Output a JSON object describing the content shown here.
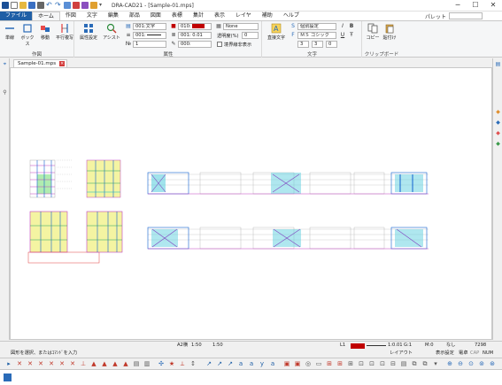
{
  "window": {
    "title": "DRA-CAD21 - [Sample-01.mps]",
    "minimize": "─",
    "maximize": "☐",
    "close": "✕"
  },
  "menu": {
    "tabs": [
      "ファイル",
      "ホーム",
      "作図",
      "文字",
      "編集",
      "部品",
      "図面",
      "表標",
      "集計",
      "表示",
      "レイヤ",
      "補助",
      "ヘルプ"
    ],
    "palette_label": "パレット"
  },
  "ribbon": {
    "draw_group": {
      "label": "作図",
      "buttons": [
        "単線",
        "ボックス",
        "移動",
        "平行複写"
      ]
    },
    "attr_group": {
      "label": "属性",
      "setting_button": "属性設定",
      "assist_button": "アシスト",
      "layer_value": "001:文字",
      "color_value": "010:",
      "line_value": "001:",
      "width_value": "001: 0.01",
      "num_value": "1",
      "pen_value": "000:",
      "hatch_value": "None",
      "transparency_label": "透明度(%)",
      "transparency_value": "0",
      "boundary_label": "境界線非表示"
    },
    "text_group": {
      "label": "文字",
      "direct_button": "直接文字",
      "style_value": "個別設定",
      "font_value": "ＭＳ ゴシック",
      "size_a": "3",
      "size_b": "3",
      "size_c": "0"
    },
    "clip_group": {
      "label": "クリップボード",
      "copy_button": "コピー",
      "paste_button": "貼付け"
    }
  },
  "document": {
    "tab_label": "Sample-01.mps",
    "tab_close": "×"
  },
  "status": {
    "paper": "A2横",
    "scale1": "1:50",
    "scale2": "1:50",
    "layer": "L1",
    "line_info": "1:0.01",
    "grid": "G:1",
    "mode": "M:0",
    "none_label": "なし",
    "count": "7298",
    "layout_label": "レイアウト",
    "display_setting": "表示設定",
    "electric": "電卓",
    "cap": "CAP",
    "num": "NUM",
    "prompt": "図形を選択、またはｺﾏﾝﾄﾞを入力"
  },
  "colors": {
    "accent": "#1f5fa6",
    "layer_red": "#c00000"
  }
}
